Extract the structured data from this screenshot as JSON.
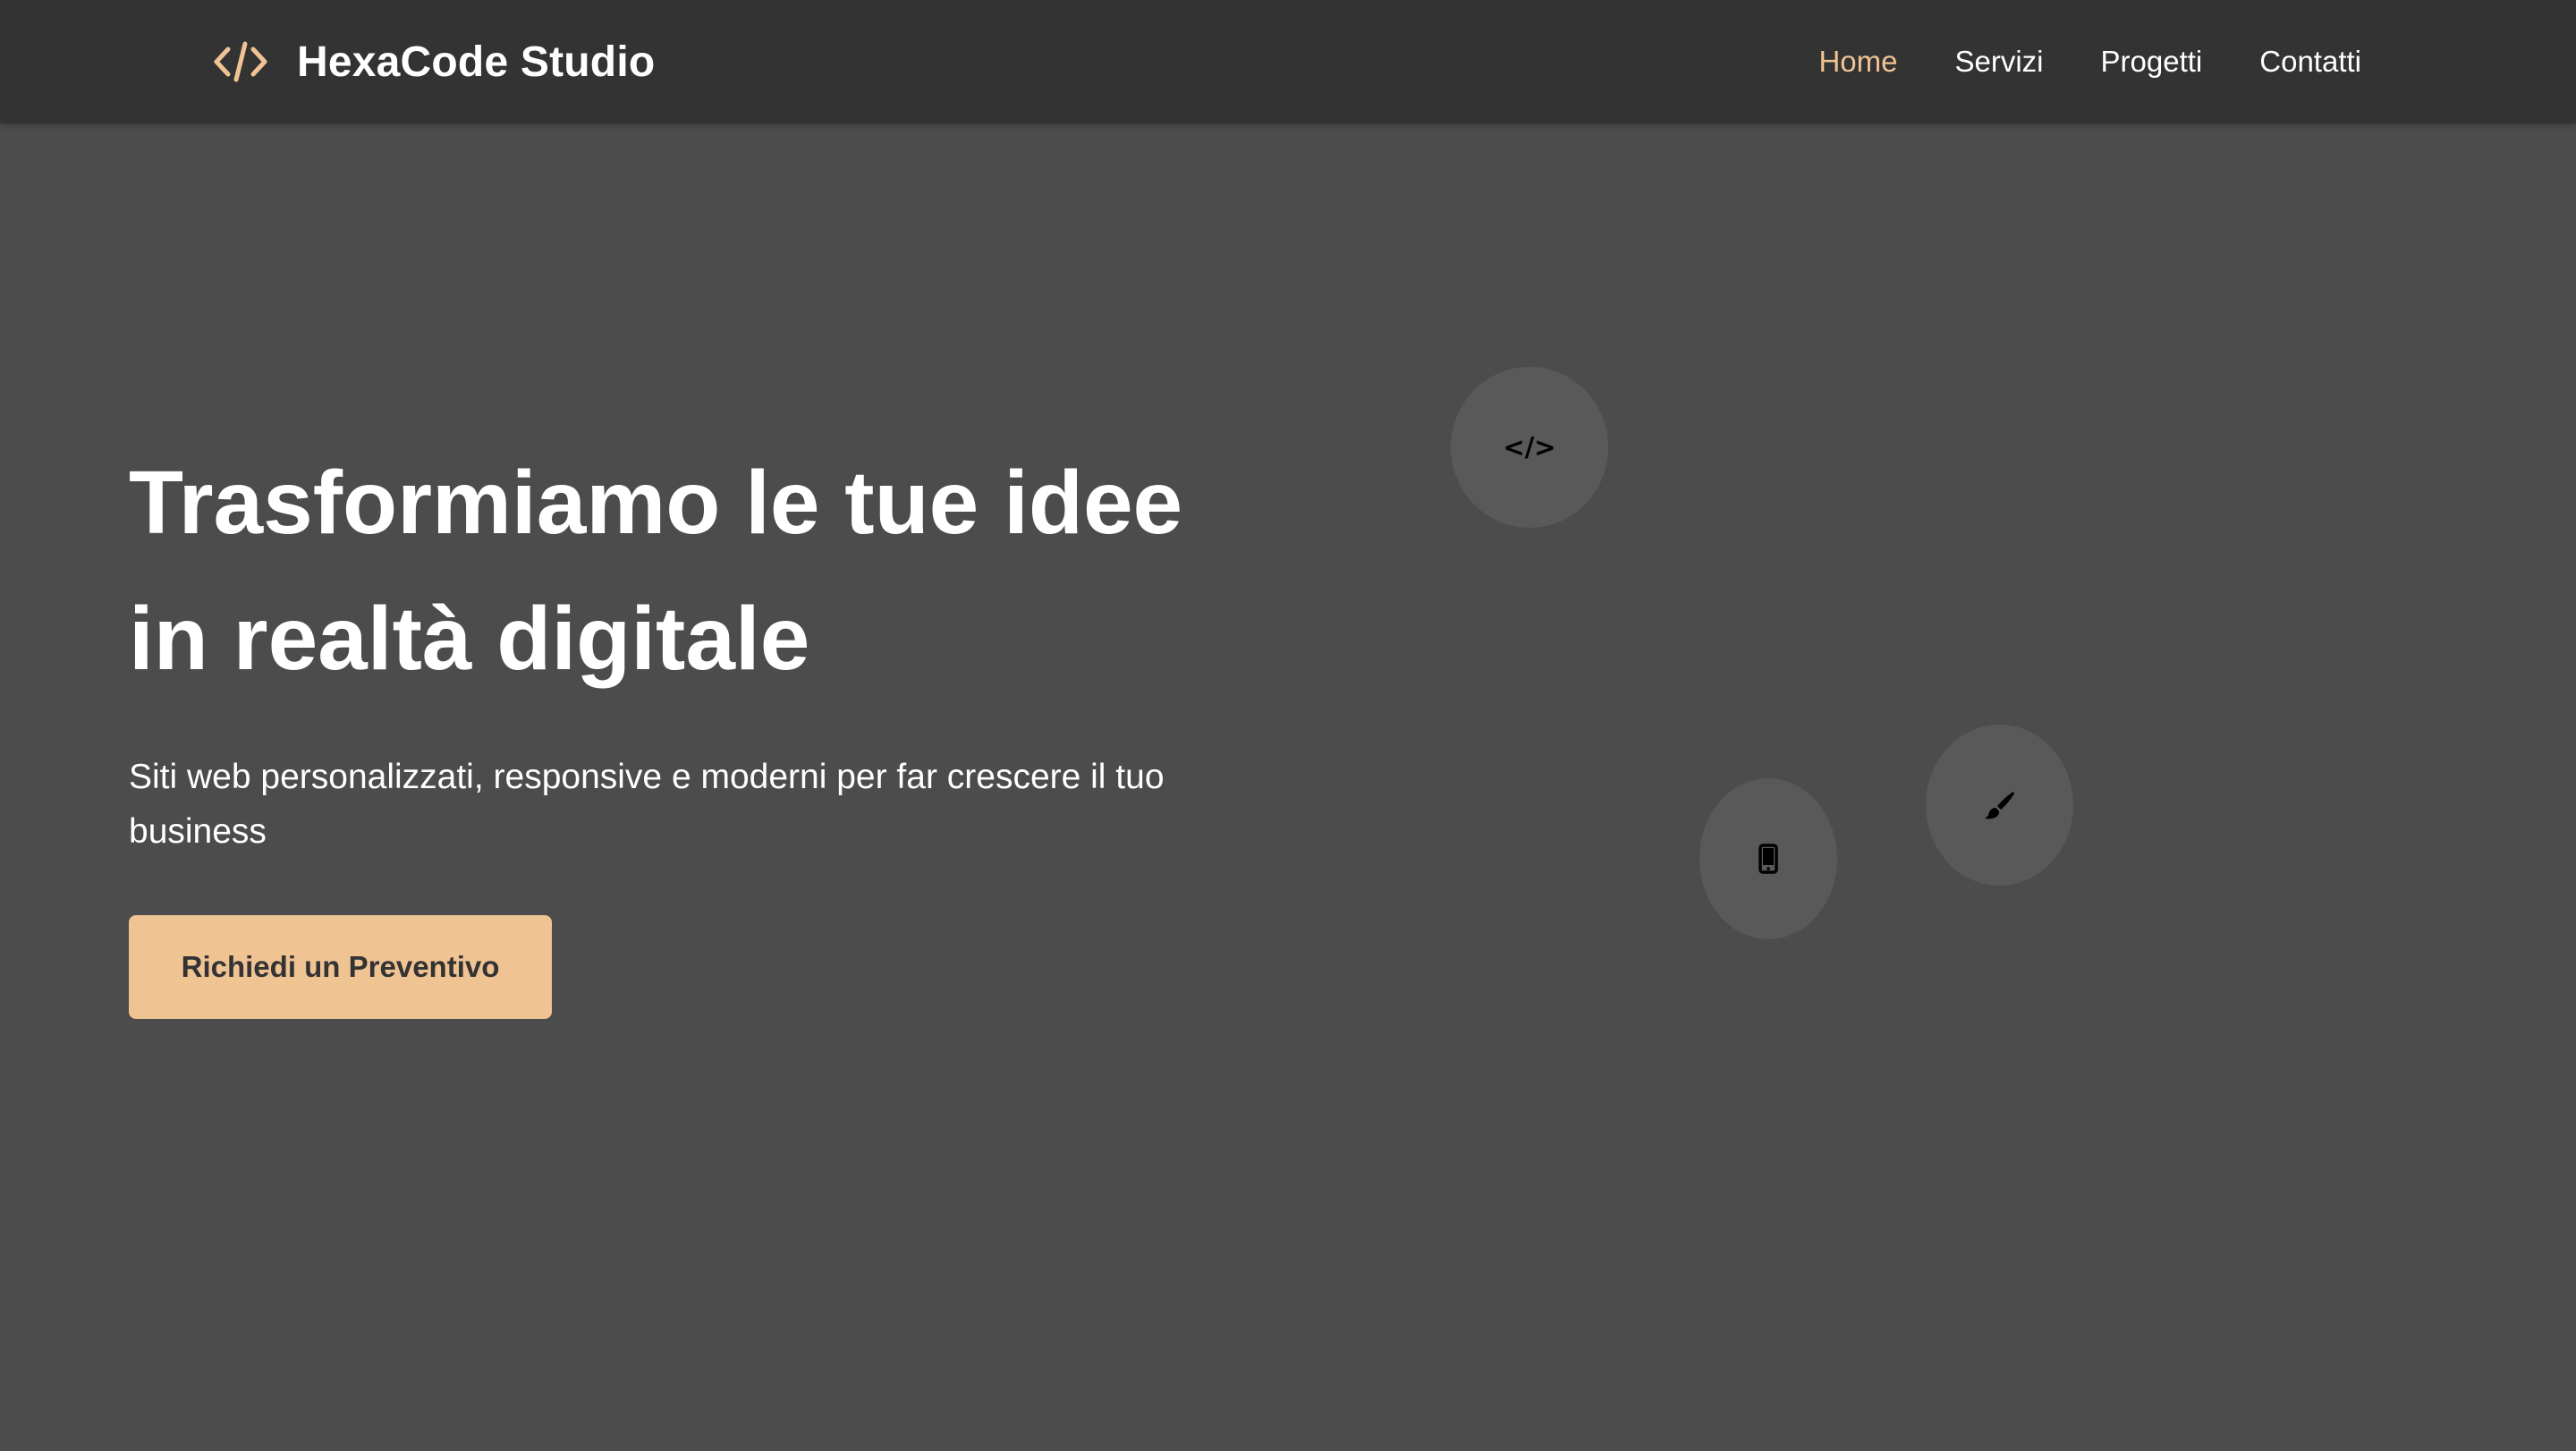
{
  "header": {
    "brand_name": "HexaCode Studio",
    "brand_icon": "code-icon",
    "nav": [
      {
        "label": "Home",
        "active": true
      },
      {
        "label": "Servizi",
        "active": false
      },
      {
        "label": "Progetti",
        "active": false
      },
      {
        "label": "Contatti",
        "active": false
      }
    ]
  },
  "hero": {
    "title_line1": "Trasformiamo le tue idee",
    "title_line2": "in realtà digitale",
    "subtitle": "Siti web personalizzati, responsive e moderni per far crescere il tuo business",
    "cta_label": "Richiedi un Preventivo"
  },
  "floating_icons": [
    {
      "icon": "code-icon",
      "glyph": "</>"
    },
    {
      "icon": "mobile-icon"
    },
    {
      "icon": "paintbrush-icon"
    }
  ],
  "colors": {
    "accent": "#f0c393",
    "header_bg": "#333333",
    "page_bg": "#4c4c4c",
    "circle_bg": "#595959",
    "text": "#ffffff"
  }
}
